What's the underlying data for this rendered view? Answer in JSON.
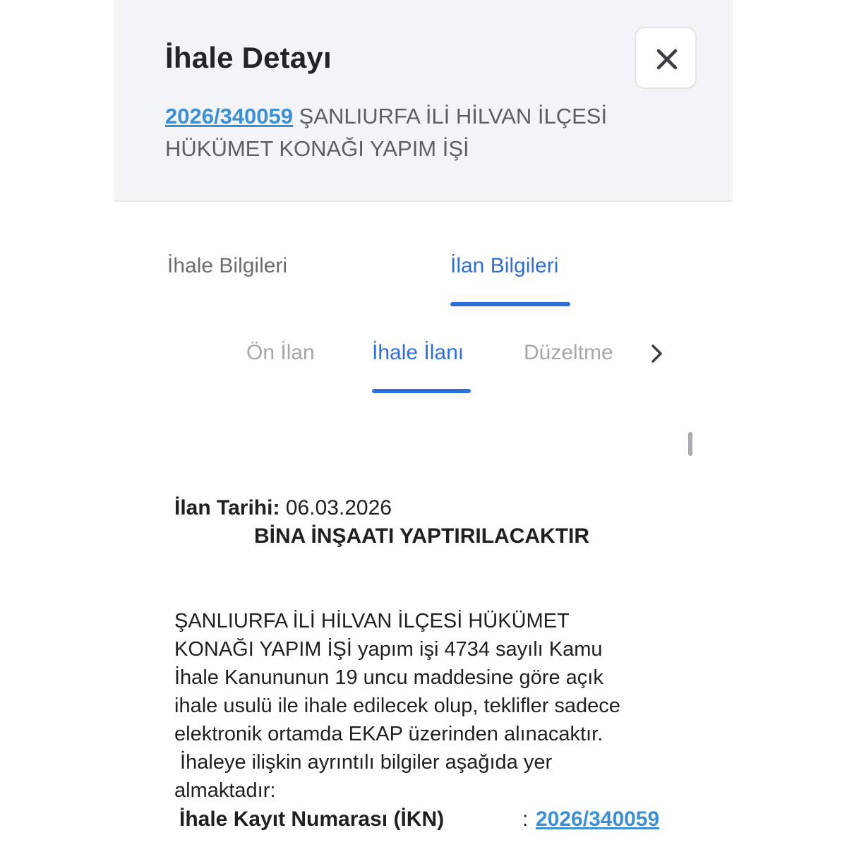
{
  "header": {
    "title": "İhale Detayı",
    "ikn": "2026/340059",
    "subject_line1": " ŞANLIURFA İLİ HİLVAN İLÇESİ",
    "subject_line2": "HÜKÜMET KONAĞI YAPIM İŞİ",
    "close_icon": "close-icon"
  },
  "tabs": [
    {
      "label": "İhale Bilgileri",
      "active": false
    },
    {
      "label": "İlan Bilgileri",
      "active": true
    }
  ],
  "subtabs": [
    {
      "label": "Ön İlan",
      "active": false
    },
    {
      "label": "İhale İlanı",
      "active": true
    },
    {
      "label": "Düzeltme",
      "active": false
    }
  ],
  "subtabs_next_icon": "chevron-right-icon",
  "document": {
    "date_label": "İlan Tarihi:",
    "date_value": " 06.03.2026",
    "heading": "BİNA İNŞAATI YAPTIRILACAKTIR",
    "paragraph_lines": [
      "ŞANLIURFA İLİ HİLVAN İLÇESİ HÜKÜMET",
      "KONAĞI YAPIM İŞİ yapım işi 4734 sayılı Kamu",
      "İhale Kanununun 19 uncu maddesine göre açık",
      "ihale usulü ile ihale edilecek olup, teklifler sadece",
      "elektronik ortamda EKAP üzerinden alınacaktır.",
      " İhaleye ilişkin ayrıntılı bilgiler aşağıda yer",
      "almaktadır:"
    ],
    "ikn_label": "İhale Kayıt Numarası (İKN)",
    "ikn_colon": ":",
    "ikn_value": "2026/340059"
  },
  "colors": {
    "accent": "#2c6fd8",
    "link": "#3d8fd4",
    "header_bg": "#f3f4f7"
  }
}
